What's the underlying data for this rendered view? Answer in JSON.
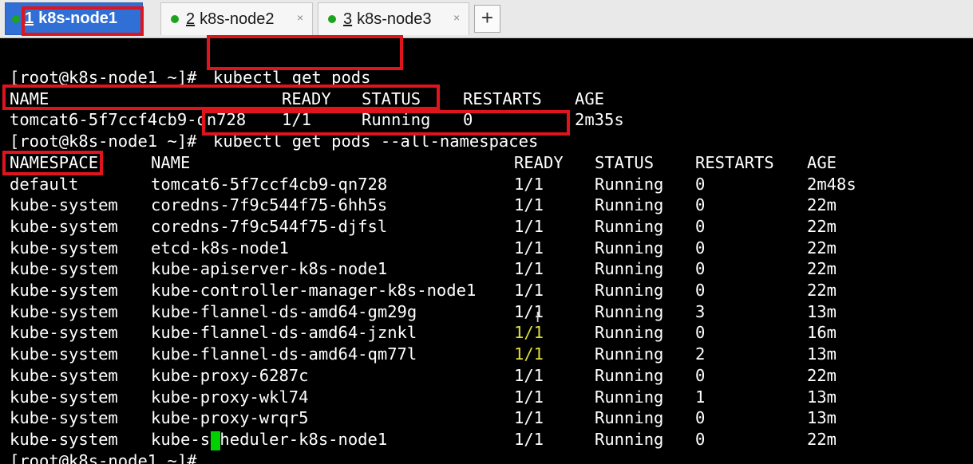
{
  "tabs": [
    {
      "number": "1",
      "label": "k8s-node1",
      "active": true
    },
    {
      "number": "2",
      "label": "k8s-node2",
      "active": false,
      "close": "×"
    },
    {
      "number": "3",
      "label": "k8s-node3",
      "active": false,
      "close": "×"
    }
  ],
  "add_tab_label": "+",
  "prompt": "[root@k8s-node1 ~]#",
  "commands": [
    "kubectl get pods",
    "kubectl get pods --all-namespaces"
  ],
  "pods_table": {
    "headers": [
      "NAME",
      "READY",
      "STATUS",
      "RESTARTS",
      "AGE"
    ],
    "rows": [
      [
        "tomcat6-5f7ccf4cb9-qn728",
        "1/1",
        "Running",
        "0",
        "2m35s"
      ]
    ]
  },
  "all_namespaces_table": {
    "headers": [
      "NAMESPACE",
      "NAME",
      "READY",
      "STATUS",
      "RESTARTS",
      "AGE"
    ],
    "rows": [
      [
        "default",
        "tomcat6-5f7ccf4cb9-qn728",
        "1/1",
        "Running",
        "0",
        "2m48s"
      ],
      [
        "kube-system",
        "coredns-7f9c544f75-6hh5s",
        "1/1",
        "Running",
        "0",
        "22m"
      ],
      [
        "kube-system",
        "coredns-7f9c544f75-djfsl",
        "1/1",
        "Running",
        "0",
        "22m"
      ],
      [
        "kube-system",
        "etcd-k8s-node1",
        "1/1",
        "Running",
        "0",
        "22m"
      ],
      [
        "kube-system",
        "kube-apiserver-k8s-node1",
        "1/1",
        "Running",
        "0",
        "22m"
      ],
      [
        "kube-system",
        "kube-controller-manager-k8s-node1",
        "1/1",
        "Running",
        "0",
        "22m"
      ],
      [
        "kube-system",
        "kube-flannel-ds-amd64-gm29g",
        "1/1",
        "Running",
        "3",
        "13m"
      ],
      [
        "kube-system",
        "kube-flannel-ds-amd64-jznkl",
        "1/1",
        "Running",
        "0",
        "16m"
      ],
      [
        "kube-system",
        "kube-flannel-ds-amd64-qm77l",
        "1/1",
        "Running",
        "2",
        "13m"
      ],
      [
        "kube-system",
        "kube-proxy-6287c",
        "1/1",
        "Running",
        "0",
        "22m"
      ],
      [
        "kube-system",
        "kube-proxy-wkl74",
        "1/1",
        "Running",
        "1",
        "13m"
      ],
      [
        "kube-system",
        "kube-proxy-wrqr5",
        "1/1",
        "Running",
        "0",
        "13m"
      ],
      [
        "kube-system",
        "kube-scheduler-k8s-node1",
        "1/1",
        "Running",
        "0",
        "22m"
      ]
    ]
  },
  "colors": {
    "highlight_box": "#e0141c",
    "cursor": "#00d000",
    "active_tab": "#2f6fd6",
    "status_dot": "#1ea31e"
  }
}
